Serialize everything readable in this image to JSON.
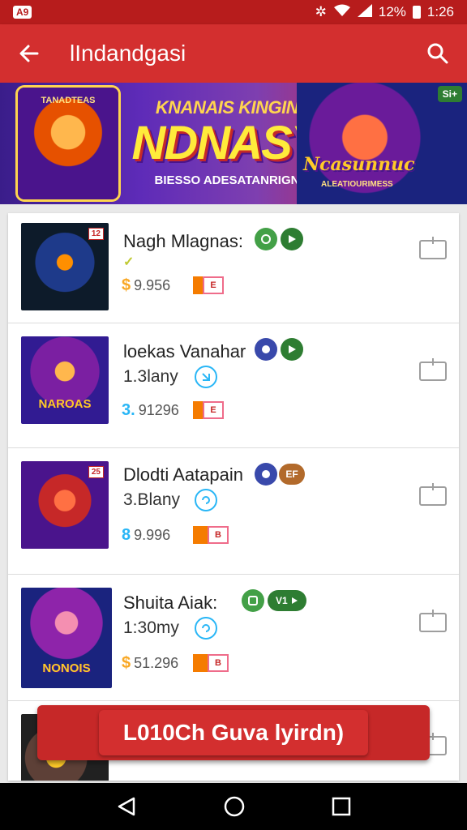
{
  "status_bar": {
    "left_badge": "A9",
    "battery": "12%",
    "time": "1:26"
  },
  "app_bar": {
    "title": "lIndandgasi"
  },
  "banner": {
    "headline_top": "KNANAIS KINGIN",
    "headline_main": "NDNASY",
    "headline_sub": "BIESSO ADESATANRIGN",
    "left_art_text": "TANADTEAS",
    "right_logo": "Ncasunnuc",
    "right_logo_sub": "ALEATIOURIMESS",
    "corner_badge": "Si+"
  },
  "games": [
    {
      "name": "Nagh Mlagnas:",
      "sub": "",
      "currency": "$",
      "price": "9.956",
      "thumb_tag": "12",
      "thumb_caption": "",
      "badge_colors": [
        "#43a047",
        "#2e7d32"
      ],
      "badge_label": ""
    },
    {
      "name": "loekas Vanahar",
      "sub": "1.3lany",
      "currency": "3.",
      "price": "91296",
      "thumb_tag": "",
      "thumb_caption": "NAROAS",
      "badge_colors": [
        "#3949ab",
        "#2e7d32"
      ],
      "badge_label": ""
    },
    {
      "name": "Dlodti Aatapain",
      "sub": "3.Blany",
      "currency": "8",
      "price": "9.996",
      "thumb_tag": "25",
      "thumb_caption": "",
      "badge_colors": [
        "#3949ab",
        "#b26a2b"
      ],
      "badge_label": "EF"
    },
    {
      "name": "Shuita Aiak:",
      "sub": "1:30my",
      "currency": "$",
      "price": "51.296",
      "thumb_tag": "",
      "thumb_caption": "NONOIS",
      "badge_colors": [
        "#43a047",
        "#2e7d32"
      ],
      "badge_label": "V1"
    }
  ],
  "install_button": {
    "label": "L010Ch Guva lyirdn)"
  },
  "colors": {
    "primary": "#d32f2f",
    "primary_dark": "#b71c1c",
    "accent": "#f57c00"
  }
}
